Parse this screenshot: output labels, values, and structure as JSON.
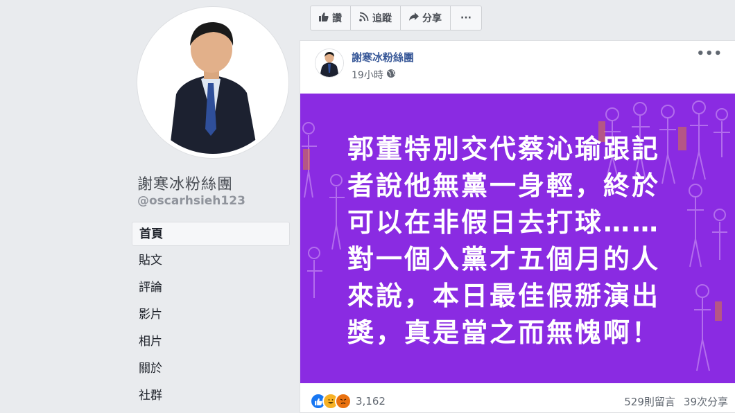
{
  "sidebar": {
    "page_name": "謝寒冰粉絲團",
    "handle": "@oscarhsieh123",
    "nav": [
      {
        "label": "首頁",
        "active": true
      },
      {
        "label": "貼文"
      },
      {
        "label": "評論"
      },
      {
        "label": "影片"
      },
      {
        "label": "相片"
      },
      {
        "label": "關於"
      },
      {
        "label": "社群"
      }
    ]
  },
  "actions": {
    "like": "讚",
    "follow": "追蹤",
    "share": "分享",
    "more": "···"
  },
  "post": {
    "author": "謝寒冰粉絲團",
    "time": "19小時",
    "more": "•••",
    "image_text": "郭董特別交代蔡沁瑜跟記\n者說他無黨一身輕，終於\n可以在非假日去打球……\n對一個入黨才五個月的人\n來說，本日最佳假掰演出\n獎，真是當之而無愧啊！",
    "reaction_count": "3,162",
    "comments": "529則留言",
    "shares": "39次分享"
  },
  "colors": {
    "image_bg": "#8a2be2",
    "link": "#385898",
    "page_bg": "#e9ebee"
  }
}
